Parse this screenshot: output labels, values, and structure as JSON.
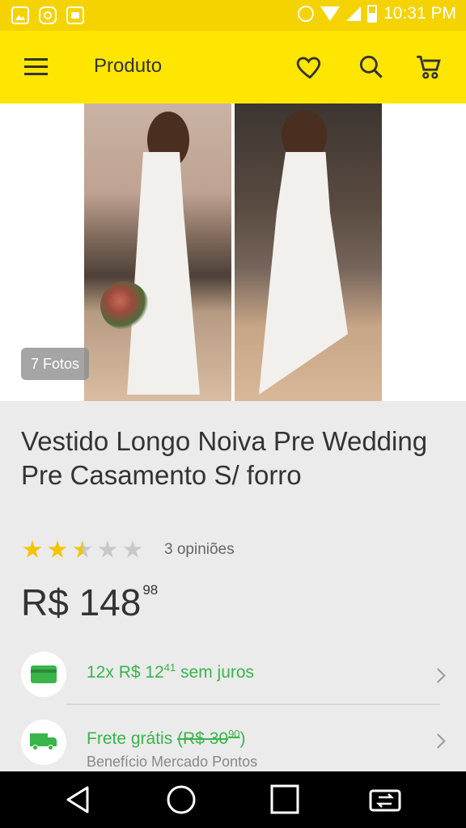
{
  "status_bar": {
    "time": "10:31 PM"
  },
  "toolbar": {
    "title": "Produto"
  },
  "gallery": {
    "photo_count": "7 Fotos"
  },
  "product": {
    "title": "Vestido Longo Noiva Pre Wedding Pre Casamento S/ forro",
    "rating": 2.5,
    "reviews": "3 opiniões",
    "price_main": "R$ 148",
    "price_cents": "98"
  },
  "installments": {
    "prefix": "12x R$ 12",
    "cents": "41",
    "suffix": " sem juros"
  },
  "shipping": {
    "label": "Frete grátis ",
    "old_price": "(R$ 30",
    "old_cents": "90",
    "old_close": ")",
    "subtext": "Benefício Mercado Pontos"
  },
  "colors": {
    "brand_yellow": "#fee600",
    "accent_green": "#39b54a",
    "star": "#f5c400"
  },
  "icons": {
    "toolbar": [
      "menu-icon",
      "heart-icon",
      "search-icon",
      "cart-icon"
    ],
    "rows": [
      "credit-card-icon",
      "truck-icon",
      "chevron-right-icon"
    ],
    "nav": [
      "back-icon",
      "home-icon",
      "recents-icon",
      "switch-app-icon"
    ]
  }
}
